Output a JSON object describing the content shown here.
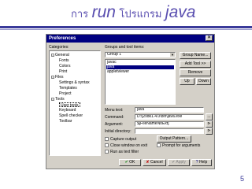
{
  "slide": {
    "title_prefix": "การ",
    "title_run": "run",
    "title_middle": "โปรแกรม",
    "title_java": "java",
    "page_number": "5"
  },
  "dialog": {
    "title": "Preferences",
    "close_glyph": "×",
    "categories_label": "Categories:",
    "tree": [
      {
        "label": "General",
        "indent": 0,
        "toggle": "-"
      },
      {
        "label": "Fonts",
        "indent": 1
      },
      {
        "label": "Colors",
        "indent": 1
      },
      {
        "label": "Print",
        "indent": 1
      },
      {
        "label": "Files",
        "indent": 0,
        "toggle": "-"
      },
      {
        "label": "Settings & syntax",
        "indent": 1
      },
      {
        "label": "Templates",
        "indent": 1
      },
      {
        "label": "Project",
        "indent": 1
      },
      {
        "label": "Tools",
        "indent": 0,
        "toggle": "-"
      },
      {
        "label": "User tools",
        "indent": 1,
        "selected": true
      },
      {
        "label": "Keyboard",
        "indent": 1
      },
      {
        "label": "Spell checker",
        "indent": 1
      },
      {
        "label": "Toolbar",
        "indent": 1
      }
    ],
    "groups_label": "Groups and tool items:",
    "group_select": "Group 1",
    "tool_items": [
      {
        "label": "javac",
        "selected": false
      },
      {
        "label": "java",
        "selected": true
      },
      {
        "label": "appletviewer",
        "selected": false
      }
    ],
    "buttons": {
      "group_name": "Group Name...",
      "add_tool": "Add Tool >>",
      "remove": "Remove",
      "up": "Up",
      "down": "Down",
      "browse": "...",
      "insert": "⊳",
      "output_pattern": "Output Pattern...",
      "ok": "OK",
      "cancel": "Cancel",
      "apply": "Apply",
      "help": "Help"
    },
    "menu_text_label": "Menu text:",
    "menu_text_value": "java",
    "command_label": "Command:",
    "command_value": "D:\\j2sdk1.4.0\\bin\\java.exe",
    "argument_label": "Argument:",
    "argument_value": "$[FileNameNoExt]",
    "initial_dir_label": "Initial directory:",
    "initial_dir_value": "",
    "checkboxes": {
      "capture_output": "Capture output",
      "close_window": "Close window on exit",
      "prompt_arguments": "Prompt for arguments",
      "run_text_filter": "Run as text filter"
    }
  }
}
